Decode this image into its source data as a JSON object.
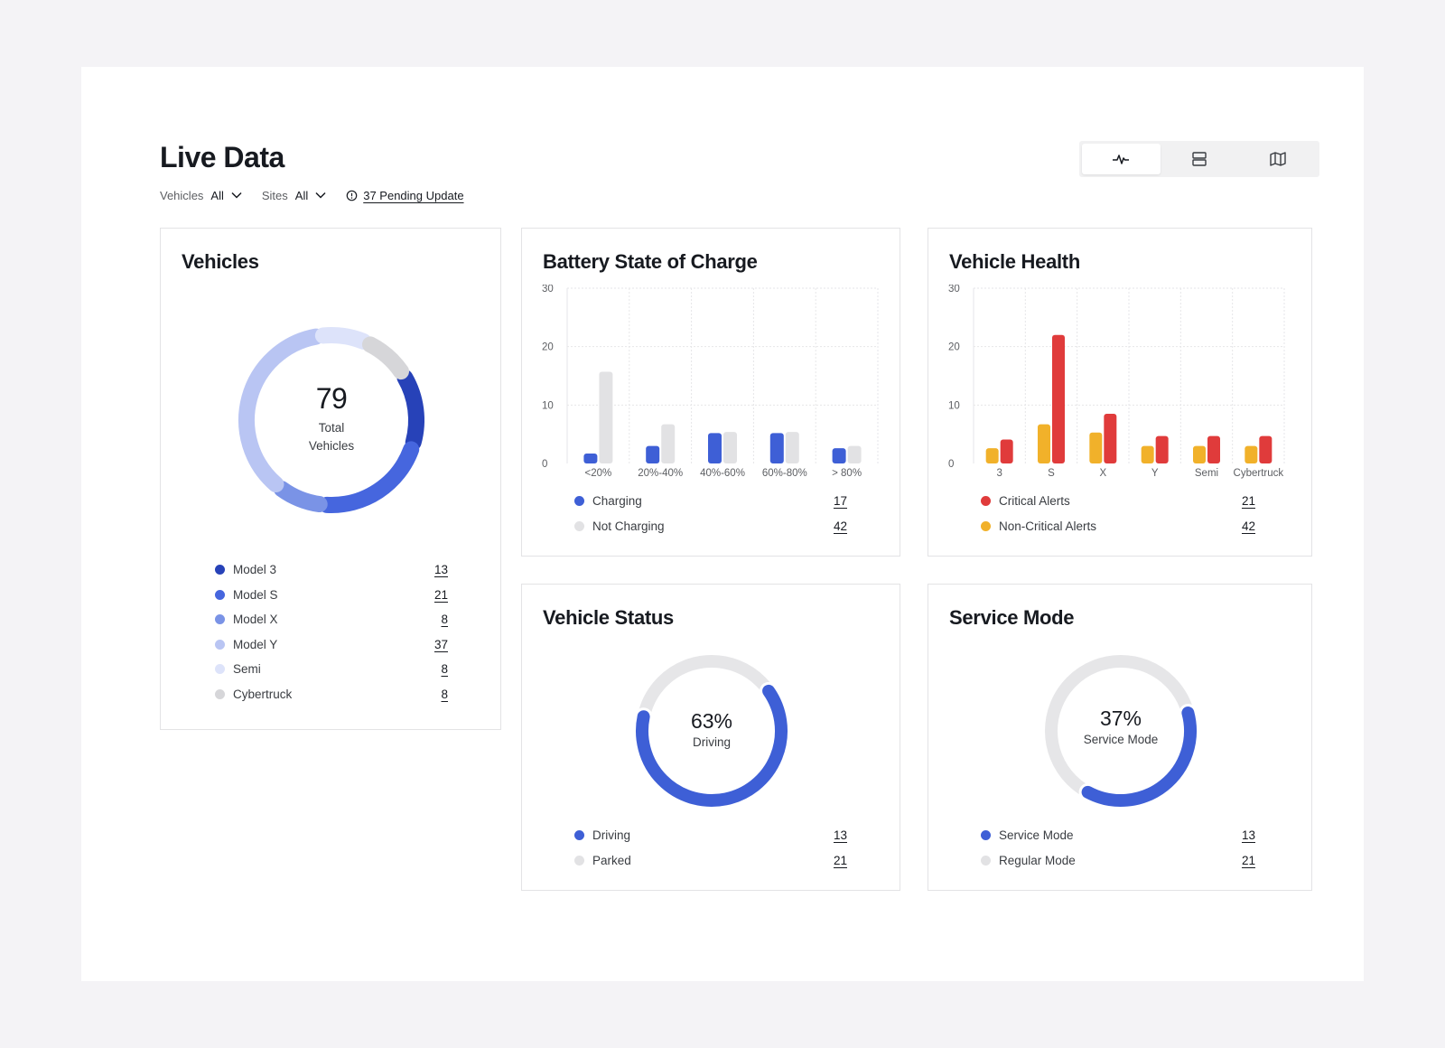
{
  "header": {
    "title": "Live Data",
    "filters": [
      {
        "label": "Vehicles",
        "value": "All"
      },
      {
        "label": "Sites",
        "value": "All"
      }
    ],
    "pending_update": "37 Pending Update",
    "view_toggle": [
      "activity-icon",
      "list-icon",
      "map-icon"
    ],
    "active_view": 0
  },
  "vehicles": {
    "title": "Vehicles",
    "total": "79",
    "total_label_1": "Total",
    "total_label_2": "Vehicles",
    "legend": [
      {
        "label": "Model 3",
        "value": "13",
        "color": "#2742b8"
      },
      {
        "label": "Model S",
        "value": "21",
        "color": "#4666de"
      },
      {
        "label": "Model X",
        "value": "8",
        "color": "#7a93e6"
      },
      {
        "label": "Model Y",
        "value": "37",
        "color": "#b9c5f3"
      },
      {
        "label": "Semi",
        "value": "8",
        "color": "#dde3fa"
      },
      {
        "label": "Cybertruck",
        "value": "8",
        "color": "#d6d6d9"
      }
    ]
  },
  "battery": {
    "title": "Battery State of Charge",
    "legend": [
      {
        "label": "Charging",
        "value": "17",
        "color": "#3e5fd6"
      },
      {
        "label": "Not Charging",
        "value": "42",
        "color": "#e2e2e4"
      }
    ]
  },
  "health": {
    "title": "Vehicle Health",
    "legend": [
      {
        "label": "Critical Alerts",
        "value": "21",
        "color": "#e03b3b"
      },
      {
        "label": "Non-Critical Alerts",
        "value": "42",
        "color": "#f1b12a"
      }
    ]
  },
  "status": {
    "title": "Vehicle Status",
    "percent": "63%",
    "center_label": "Driving",
    "fraction": 0.63,
    "legend": [
      {
        "label": "Driving",
        "value": "13",
        "color": "#3e5fd6"
      },
      {
        "label": "Parked",
        "value": "21",
        "color": "#e2e2e4"
      }
    ]
  },
  "service": {
    "title": "Service Mode",
    "percent": "37%",
    "center_label": "Service Mode",
    "fraction": 0.37,
    "legend": [
      {
        "label": "Service Mode",
        "value": "13",
        "color": "#3e5fd6"
      },
      {
        "label": "Regular Mode",
        "value": "21",
        "color": "#e2e2e4"
      }
    ]
  },
  "chart_data": [
    {
      "type": "bar",
      "title": "Battery State of Charge",
      "categories": [
        "<20%",
        "20%-40%",
        "40%-60%",
        "60%-80%",
        "> 80%"
      ],
      "yticks": [
        "30",
        "20",
        "10",
        "0"
      ],
      "ylim": [
        0,
        30
      ],
      "grid": true,
      "series": [
        {
          "name": "Charging",
          "values": [
            1.7,
            3,
            5.2,
            5.2,
            2.6
          ],
          "color": "#3e5fd6"
        },
        {
          "name": "Not Charging",
          "values": [
            15.7,
            6.7,
            5.4,
            5.4,
            3
          ],
          "color": "#e2e2e4"
        }
      ]
    },
    {
      "type": "bar",
      "title": "Vehicle Health",
      "categories": [
        "3",
        "S",
        "X",
        "Y",
        "Semi",
        "Cybertruck"
      ],
      "yticks": [
        "30",
        "20",
        "10",
        "0"
      ],
      "ylim": [
        0,
        30
      ],
      "grid": true,
      "series": [
        {
          "name": "Non-Critical Alerts",
          "values": [
            2.6,
            6.7,
            5.3,
            3,
            3,
            3
          ],
          "color": "#f1b12a"
        },
        {
          "name": "Critical Alerts",
          "values": [
            4.1,
            22,
            8.5,
            4.7,
            4.7,
            4.7
          ],
          "color": "#e03b3b"
        }
      ]
    }
  ]
}
